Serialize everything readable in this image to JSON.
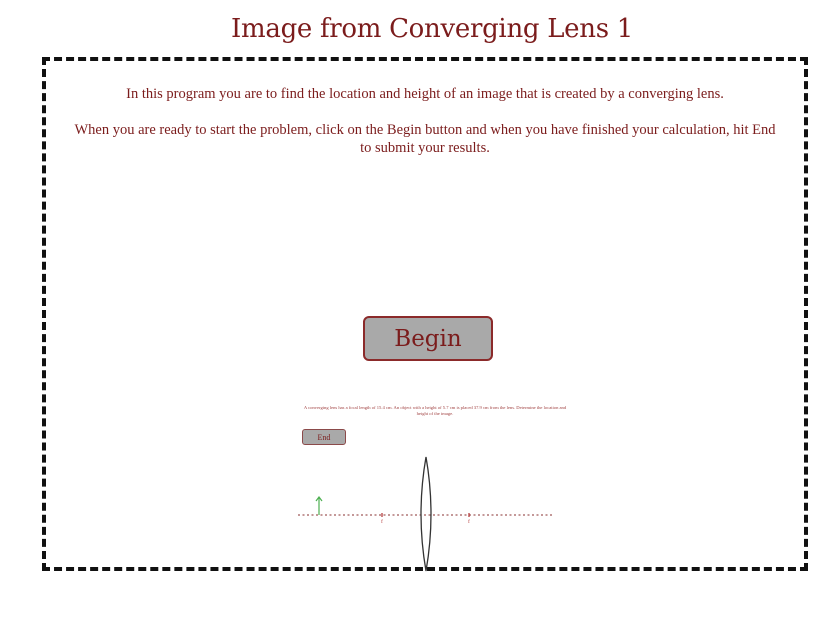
{
  "header": {
    "title": "Image from Converging Lens 1"
  },
  "content": {
    "intro": "In this program you are to find the location and height of an image that is created by a converging lens.",
    "instructions": "When you are ready to start the problem, click on the Begin button and when you have finished your calculation, hit End to submit your results."
  },
  "buttons": {
    "begin_label": "Begin",
    "end_label": "End"
  },
  "problem": {
    "text": "A converging lens has a focal length of 15.4 cm. An object with a height of 5.7 cm is placed 37.9 cm from the lens. Determine the location and height of the image."
  },
  "diagram": {
    "focal_label_left": "f",
    "focal_label_right": "f",
    "colors": {
      "axis": "#a05a5a",
      "object": "#4caf50",
      "lens": "#333333",
      "focal": "#b03030"
    }
  },
  "colors": {
    "text": "#7b1c1c",
    "button_bg": "#a9a9a9",
    "button_border": "#8b2a2a"
  }
}
